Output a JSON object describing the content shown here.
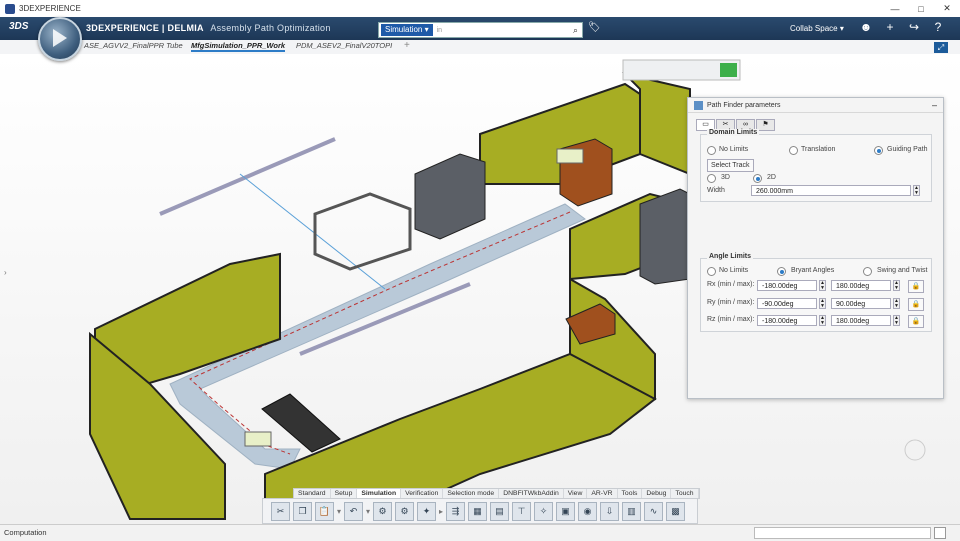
{
  "window": {
    "title": "3DEXPERIENCE",
    "controls": [
      "—",
      "□",
      "✕"
    ]
  },
  "topbar": {
    "brand": "3DEXPERIENCE | DELMIA",
    "app_name": "Assembly Path Optimization",
    "search_scope": "Simulation",
    "search_placeholder": "in",
    "collab_space": "Collab Space"
  },
  "tabs": [
    {
      "label": "ASE_AGVV2_FinalPPR Tube"
    },
    {
      "label": "MfgSimulation_PPR_Work"
    },
    {
      "label": "PDM_ASEV2_FinalV20TOPI"
    }
  ],
  "active_tab_index": 1,
  "path_finder": {
    "title": "Path Finder parameters",
    "domain_limits": {
      "title": "Domain Limits",
      "options": [
        "No Limits",
        "Translation",
        "Guiding Path"
      ],
      "selected": "Guiding Path",
      "select_track_label": "Select Track",
      "dimension_options": [
        "3D",
        "2D"
      ],
      "dimension_selected": "2D",
      "width_label": "Width",
      "width_value": "260.000mm"
    },
    "angle_limits": {
      "title": "Angle Limits",
      "options": [
        "No Limits",
        "Bryant Angles",
        "Swing and Twist"
      ],
      "selected": "Bryant Angles",
      "rows": [
        {
          "label": "Rx (min / max):",
          "min": "-180.00deg",
          "max": "180.00deg"
        },
        {
          "label": "Ry (min / max):",
          "min": "-90.00deg",
          "max": "90.00deg"
        },
        {
          "label": "Rz (min / max):",
          "min": "-180.00deg",
          "max": "180.00deg"
        }
      ]
    }
  },
  "action_bar": {
    "tabs": [
      "Standard",
      "Setup",
      "Simulation",
      "Verification",
      "Selection mode",
      "DNBFITWkbAddin",
      "View",
      "AR-VR",
      "Tools",
      "Debug",
      "Touch"
    ],
    "active_tab": "Simulation"
  },
  "status": {
    "text": "Computation"
  }
}
